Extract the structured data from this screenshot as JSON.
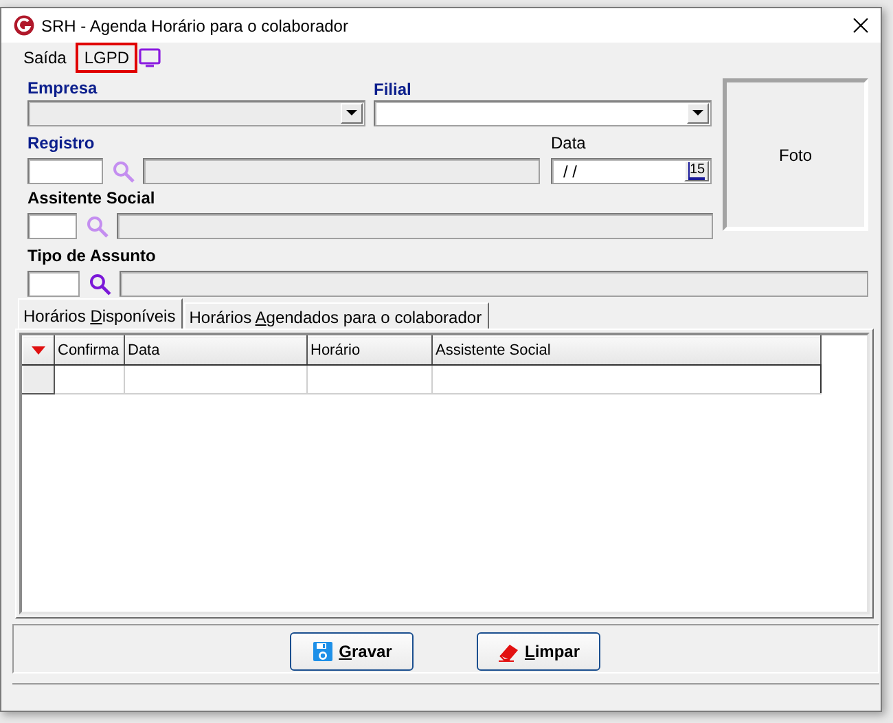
{
  "window": {
    "title": "SRH - Agenda Horário para o colaborador"
  },
  "menu": [
    {
      "label": "Saída",
      "highlighted": false
    },
    {
      "label": "LGPD",
      "highlighted": true
    }
  ],
  "form": {
    "empresa": {
      "label": "Empresa",
      "disabled": true
    },
    "filial": {
      "label": "Filial",
      "disabled": false
    },
    "registro": {
      "label": "Registro",
      "lookup_disabled": true
    },
    "data": {
      "label": "Data",
      "value": "/ /",
      "calendar_button": "15"
    },
    "assistente": {
      "label": "Assitente Social",
      "lookup_disabled": true
    },
    "assunto": {
      "label": "Tipo de Assunto",
      "lookup_disabled": false
    },
    "photo": {
      "label": "Foto"
    }
  },
  "tabs": [
    {
      "before": "Horários ",
      "access_key": "D",
      "after": "isponíveis",
      "selected": true
    },
    {
      "before": "Horários ",
      "access_key": "A",
      "after": "gendados para o colaborador",
      "selected": false
    }
  ],
  "table": {
    "columns": [
      "Confirma",
      "Data",
      "Horário",
      "Assistente Social"
    ]
  },
  "buttons": [
    {
      "kind": "save",
      "access_key": "G",
      "after": "ravar"
    },
    {
      "kind": "clear",
      "access_key": "L",
      "after": "impar"
    }
  ]
}
